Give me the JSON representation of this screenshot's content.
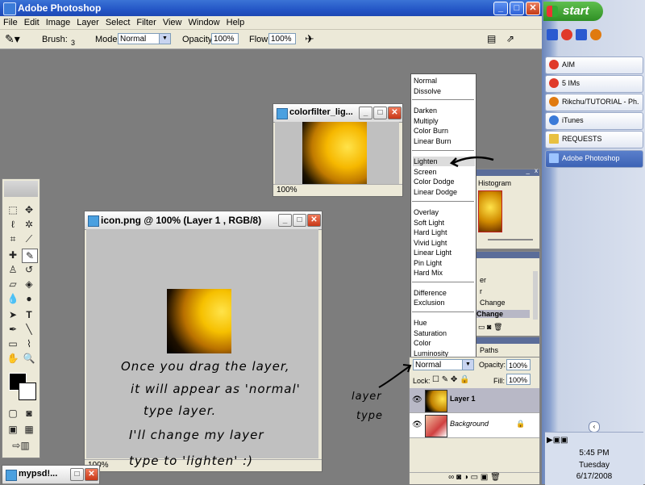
{
  "app": {
    "title": "Adobe Photoshop"
  },
  "menu": [
    "File",
    "Edit",
    "Image",
    "Layer",
    "Select",
    "Filter",
    "View",
    "Window",
    "Help"
  ],
  "options": {
    "brush_label": "Brush:",
    "brush_size": "3",
    "mode_label": "Mode:",
    "mode_value": "Normal",
    "opacity_label": "Opacity:",
    "opacity_value": "100%",
    "flow_label": "Flow:",
    "flow_value": "100%"
  },
  "docs": {
    "colorfilter": {
      "title": "colorfilter_lig...",
      "zoom": "100%"
    },
    "icon": {
      "title": "icon.png @ 100% (Layer 1 , RGB/8)",
      "zoom": "100%"
    },
    "mypsd": {
      "title": "mypsd!..."
    }
  },
  "blend_modes": [
    "Normal",
    "Dissolve",
    "Darken",
    "Multiply",
    "Color Burn",
    "Linear Burn",
    "Lighten",
    "Screen",
    "Color Dodge",
    "Linear Dodge",
    "Overlay",
    "Soft Light",
    "Hard Light",
    "Vivid Light",
    "Linear Light",
    "Pin Light",
    "Hard Mix",
    "Difference",
    "Exclusion",
    "Hue",
    "Saturation",
    "Color",
    "Luminosity"
  ],
  "panels": {
    "histogram_tab": "Histogram",
    "history_items": [
      "er",
      "r",
      "Change",
      "Change"
    ],
    "paths_tab": "Paths"
  },
  "layers": {
    "mode_value": "Normal",
    "opacity_label": "Opacity:",
    "opacity_value": "100%",
    "lock_label": "Lock:",
    "fill_label": "Fill:",
    "fill_value": "100%",
    "items": [
      {
        "name": "Layer 1",
        "active": true
      },
      {
        "name": "Background",
        "active": false
      }
    ]
  },
  "annotations": {
    "main_line1": "Once you drag the layer,",
    "main_line2": "it will appear as 'normal'",
    "main_line3": "type layer.",
    "main_line4": "I'll change my layer",
    "main_line5": "type to 'lighten' :)",
    "side_line1": "layer",
    "side_line2": "type"
  },
  "taskbar": {
    "start_label": "start",
    "tasks": [
      {
        "label": "AIM",
        "color": "#e03a2a"
      },
      {
        "label": "5 IMs",
        "color": "#e03a2a"
      },
      {
        "label": "Rikchu/TUTORIAL - Ph...",
        "color": "#e07a10"
      },
      {
        "label": "iTunes",
        "color": "#3a7ad8"
      },
      {
        "label": "REQUESTS",
        "color": "#e8c040"
      },
      {
        "label": "Adobe Photoshop",
        "color": "#2a60c0"
      }
    ],
    "clock": {
      "time": "5:45 PM",
      "day": "Tuesday",
      "date": "6/17/2008"
    }
  },
  "colors": {
    "accent": "#2456c6",
    "workspace": "#7d7d7d"
  }
}
